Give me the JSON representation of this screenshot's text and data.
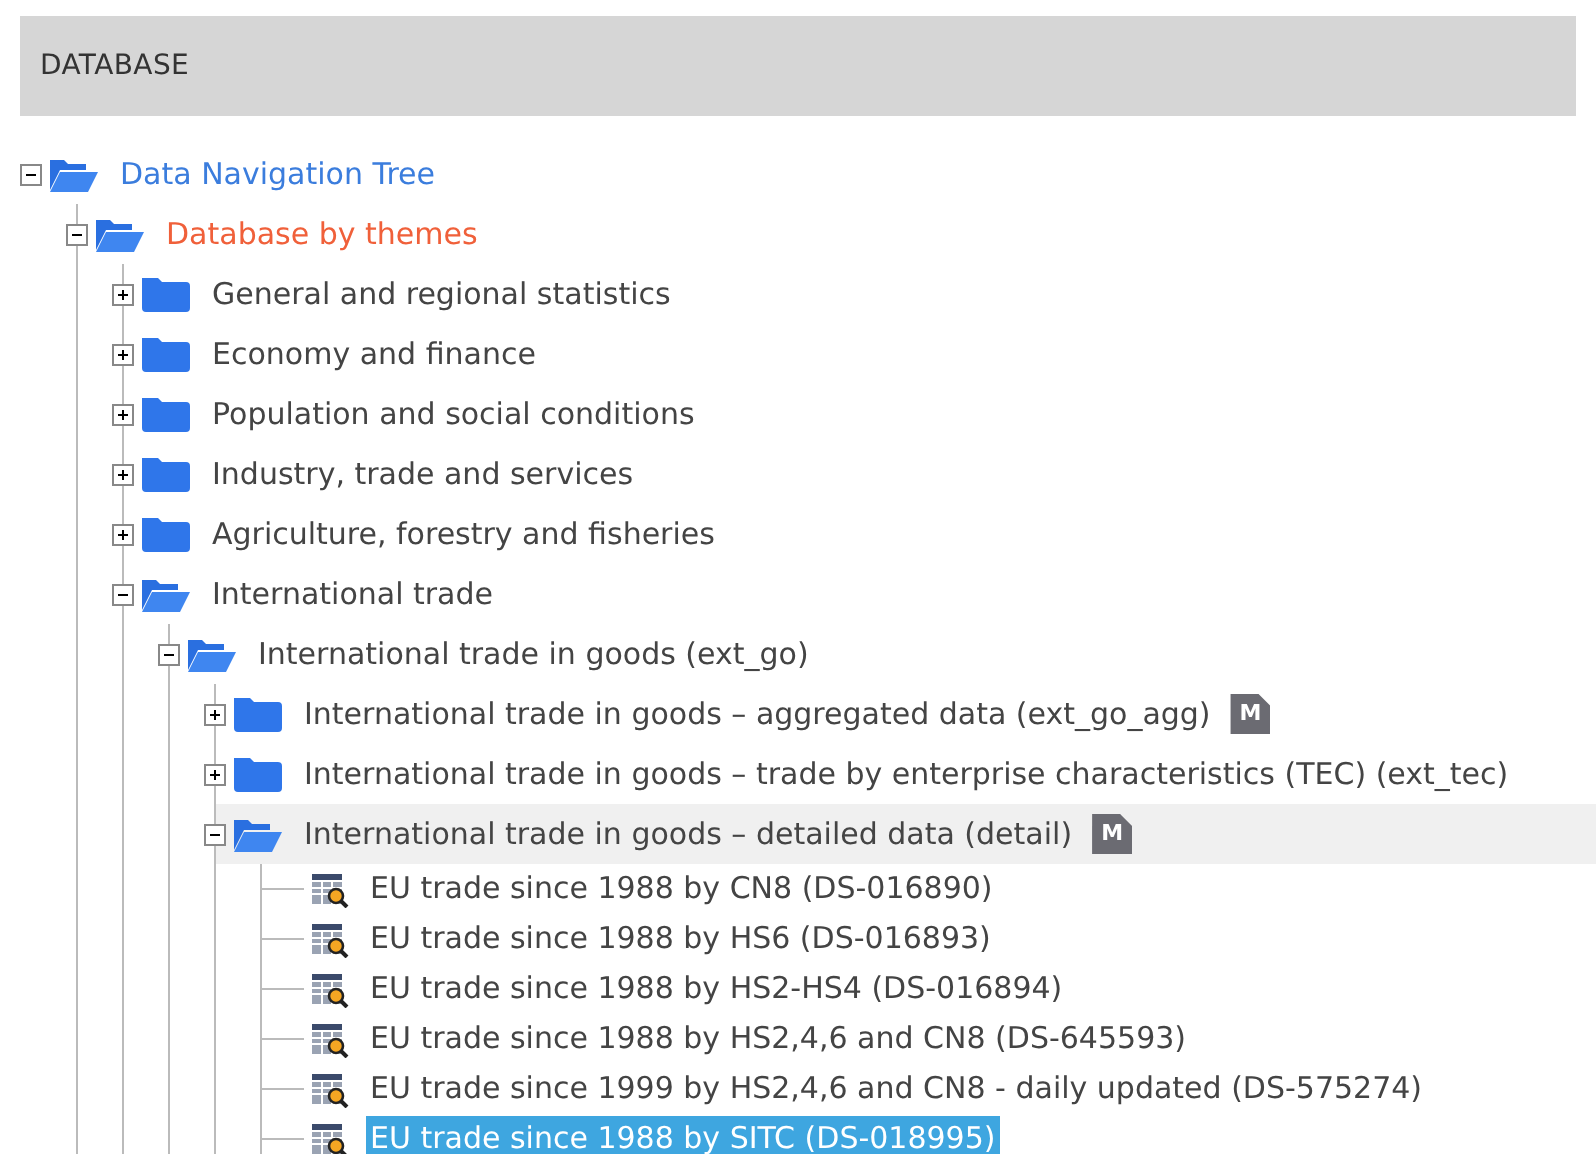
{
  "panel": {
    "title": "DATABASE"
  },
  "tree": [
    {
      "label": "Data Navigation Tree",
      "kind": "folder",
      "expanded": true,
      "color": "#3b7ddd",
      "children": [
        {
          "label": "Database by themes",
          "kind": "folder",
          "expanded": true,
          "color": "#f0603a",
          "children": [
            {
              "label": "General and regional statistics",
              "kind": "folder",
              "expanded": false
            },
            {
              "label": "Economy and finance",
              "kind": "folder",
              "expanded": false
            },
            {
              "label": "Population and social conditions",
              "kind": "folder",
              "expanded": false
            },
            {
              "label": "Industry, trade and services",
              "kind": "folder",
              "expanded": false
            },
            {
              "label": "Agriculture, forestry and fisheries",
              "kind": "folder",
              "expanded": false
            },
            {
              "label": "International trade",
              "kind": "folder",
              "expanded": true,
              "children": [
                {
                  "label": "International trade in goods (ext_go)",
                  "kind": "folder",
                  "expanded": true,
                  "children": [
                    {
                      "label": "International trade in goods – aggregated data (ext_go_agg)",
                      "kind": "folder",
                      "expanded": false,
                      "badge": "M"
                    },
                    {
                      "label": "International trade in goods – trade by enterprise characteristics (TEC) (ext_tec)",
                      "kind": "folder",
                      "expanded": false
                    },
                    {
                      "label": "International trade in goods – detailed data (detail)",
                      "kind": "folder",
                      "expanded": true,
                      "hovered": true,
                      "badge": "M",
                      "children": [
                        {
                          "label": "EU trade since 1988 by CN8 (DS-016890)",
                          "kind": "dataset",
                          "selected": false
                        },
                        {
                          "label": "EU trade since 1988 by HS6 (DS-016893)",
                          "kind": "dataset",
                          "selected": false
                        },
                        {
                          "label": "EU trade since 1988 by HS2-HS4 (DS-016894)",
                          "kind": "dataset",
                          "selected": false
                        },
                        {
                          "label": "EU trade since 1988 by HS2,4,6 and CN8 (DS-645593)",
                          "kind": "dataset",
                          "selected": false
                        },
                        {
                          "label": "EU trade since 1999 by HS2,4,6 and CN8 - daily updated (DS-575274)",
                          "kind": "dataset",
                          "selected": false
                        },
                        {
                          "label": "EU trade since 1988 by SITC (DS-018995)",
                          "kind": "dataset",
                          "selected": true
                        }
                      ]
                    }
                  ]
                }
              ]
            }
          ]
        }
      ]
    }
  ]
}
